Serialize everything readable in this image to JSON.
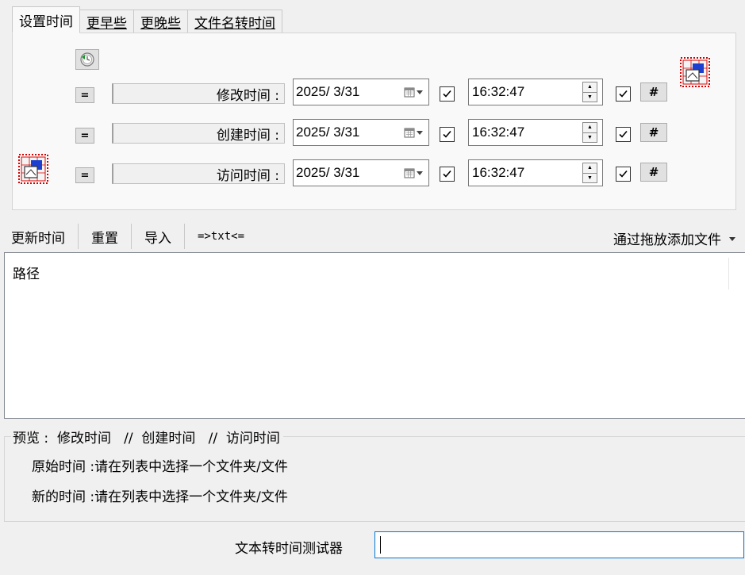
{
  "tabs": [
    {
      "label": "设置时间",
      "active": true
    },
    {
      "label": "更早些",
      "active": false
    },
    {
      "label": "更晚些",
      "active": false
    },
    {
      "label": "文件名转时间",
      "active": false
    }
  ],
  "rows": [
    {
      "eq": "=",
      "label": "修改时间 :",
      "date": "2025/ 3/31",
      "date_checked": true,
      "time": "16:32:47",
      "time_checked": true,
      "hash": "#"
    },
    {
      "eq": "=",
      "label": "创建时间 :",
      "date": "2025/ 3/31",
      "date_checked": true,
      "time": "16:32:47",
      "time_checked": true,
      "hash": "#"
    },
    {
      "eq": "=",
      "label": "访问时间 :",
      "date": "2025/ 3/31",
      "date_checked": true,
      "time": "16:32:47",
      "time_checked": true,
      "hash": "#"
    }
  ],
  "toolbar": {
    "update": "更新时间",
    "reset": "重置",
    "import": "导入",
    "txt": "=>txt<=",
    "drag_drop": "通过拖放添加文件"
  },
  "list": {
    "column_path": "路径"
  },
  "preview": {
    "legend": "预览 :  修改时间   //  创建时间   //  访问时间",
    "original_label": "原始时间 :",
    "original_value": "请在列表中选择一个文件夹/文件",
    "new_label": "新的时间 :",
    "new_value": "请在列表中选择一个文件夹/文件"
  },
  "tester": {
    "label": "文本转时间测试器",
    "value": ""
  },
  "colors": {
    "accent": "#0078d7",
    "icon_red": "#d40000",
    "icon_blue": "#1c3fd0"
  }
}
